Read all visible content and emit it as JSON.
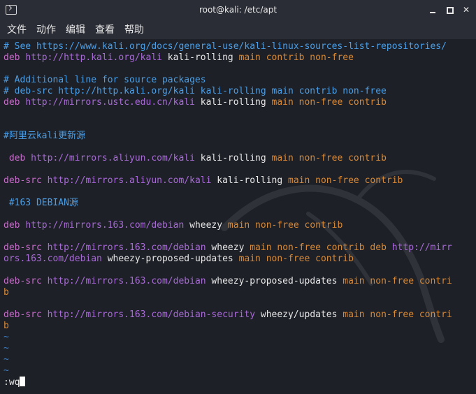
{
  "window": {
    "title": "root@kali: /etc/apt"
  },
  "menu": [
    "文件",
    "动作",
    "编辑",
    "查看",
    "帮助"
  ],
  "lines": [
    [
      {
        "t": "# See https://www.kali.org/docs/general-use/kali-linux-sources-list-repositories/",
        "c": "c-comment"
      }
    ],
    [
      {
        "t": "deb ",
        "c": "c-kw"
      },
      {
        "t": "http://http.kali.org/kali",
        "c": "c-url"
      },
      {
        "t": " kali-rolling ",
        "c": "c-plain"
      },
      {
        "t": "main contrib non-free",
        "c": "c-orange"
      }
    ],
    [],
    [
      {
        "t": "# Additional line for source packages",
        "c": "c-comment"
      }
    ],
    [
      {
        "t": "# deb-src http://http.kali.org/kali kali-rolling main contrib non-free",
        "c": "c-comment"
      }
    ],
    [
      {
        "t": "deb ",
        "c": "c-kw"
      },
      {
        "t": "http://mirrors.ustc.edu.cn/kali",
        "c": "c-url"
      },
      {
        "t": " kali-rolling ",
        "c": "c-plain"
      },
      {
        "t": "main non-free contrib",
        "c": "c-orange"
      }
    ],
    [],
    [],
    [
      {
        "t": "#阿里云kali更新源",
        "c": "c-comment"
      }
    ],
    [],
    [
      {
        "t": " deb ",
        "c": "c-kw"
      },
      {
        "t": "http://mirrors.aliyun.com/kali",
        "c": "c-url"
      },
      {
        "t": " kali-rolling ",
        "c": "c-plain"
      },
      {
        "t": "main non-free contrib",
        "c": "c-orange"
      }
    ],
    [],
    [
      {
        "t": "deb-src ",
        "c": "c-kw"
      },
      {
        "t": "http://mirrors.aliyun.com/kali",
        "c": "c-url"
      },
      {
        "t": " kali-rolling ",
        "c": "c-plain"
      },
      {
        "t": "main non-free contrib",
        "c": "c-orange"
      }
    ],
    [],
    [
      {
        "t": " #163 DEBIAN源",
        "c": "c-comment"
      }
    ],
    [],
    [
      {
        "t": "deb ",
        "c": "c-kw"
      },
      {
        "t": "http://mirrors.163.com/debian",
        "c": "c-url"
      },
      {
        "t": " wheezy ",
        "c": "c-plain"
      },
      {
        "t": "main non-free contrib",
        "c": "c-orange"
      }
    ],
    [],
    [
      {
        "t": "deb-src ",
        "c": "c-kw"
      },
      {
        "t": "http://mirrors.163.com/debian",
        "c": "c-url"
      },
      {
        "t": " wheezy ",
        "c": "c-plain"
      },
      {
        "t": "main non-free contrib deb ",
        "c": "c-orange"
      },
      {
        "t": "http://mirr",
        "c": "c-url"
      }
    ],
    [
      {
        "t": "ors.163.com/debian",
        "c": "c-url"
      },
      {
        "t": " wheezy-proposed-updates ",
        "c": "c-plain"
      },
      {
        "t": "main non-free contrib",
        "c": "c-orange"
      }
    ],
    [],
    [
      {
        "t": "deb-src ",
        "c": "c-kw"
      },
      {
        "t": "http://mirrors.163.com/debian",
        "c": "c-url"
      },
      {
        "t": " wheezy-proposed-updates ",
        "c": "c-plain"
      },
      {
        "t": "main non-free contri",
        "c": "c-orange"
      }
    ],
    [
      {
        "t": "b",
        "c": "c-orange"
      }
    ],
    [],
    [
      {
        "t": "deb-src ",
        "c": "c-kw"
      },
      {
        "t": "http://mirrors.163.com/debian-security",
        "c": "c-url"
      },
      {
        "t": " wheezy/updates ",
        "c": "c-plain"
      },
      {
        "t": "main non-free contri",
        "c": "c-orange"
      }
    ],
    [
      {
        "t": "b",
        "c": "c-orange"
      }
    ],
    [
      {
        "t": "~",
        "c": "c-tilde"
      }
    ],
    [
      {
        "t": "~",
        "c": "c-tilde"
      }
    ],
    [
      {
        "t": "~",
        "c": "c-tilde"
      }
    ],
    [
      {
        "t": "~",
        "c": "c-tilde"
      }
    ],
    [
      {
        "t": ":wq",
        "c": "c-plain"
      }
    ]
  ],
  "colors": {
    "background": "#1d2027",
    "titlebar": "#2a2d35",
    "comment": "#4a9fe8",
    "keyword": "#c56cc9",
    "url": "#a86ad6",
    "value": "#d98936"
  }
}
